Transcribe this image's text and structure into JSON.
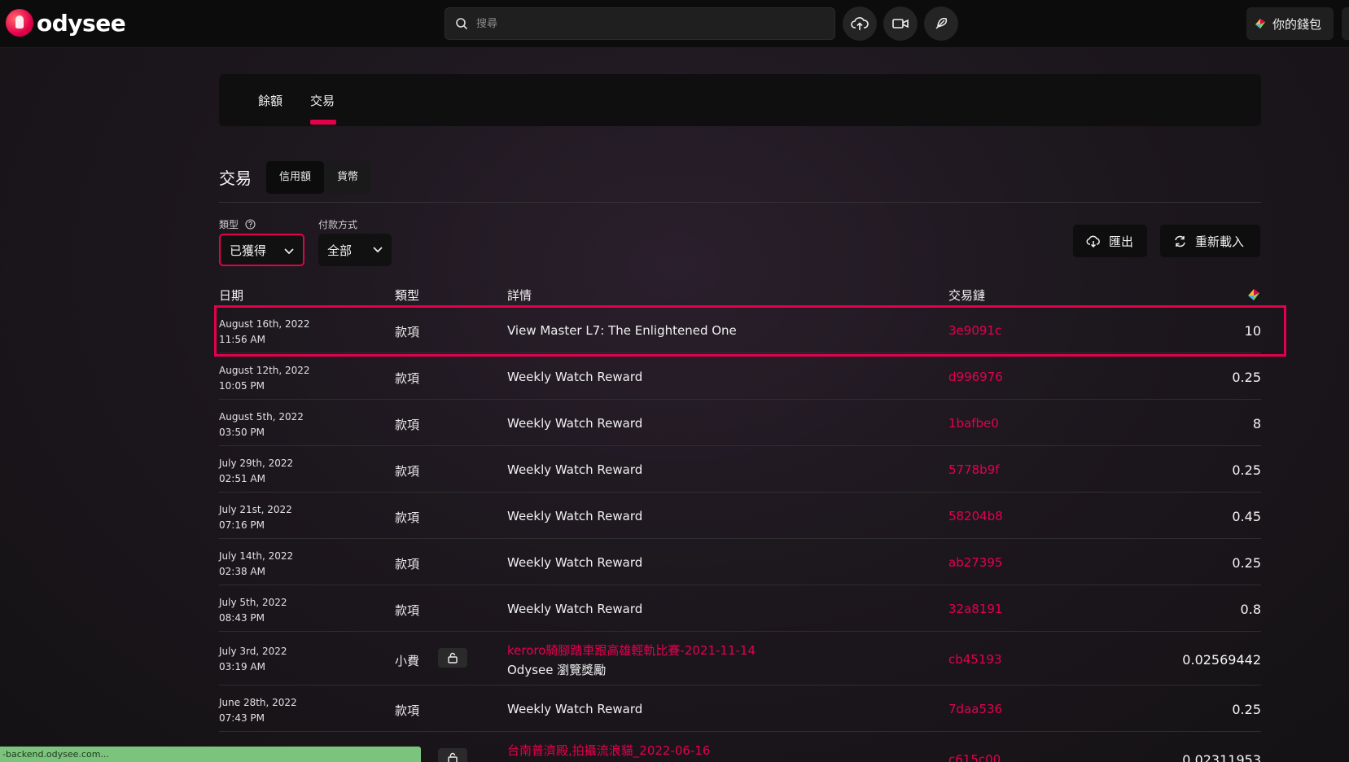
{
  "header": {
    "logo_text": "odysee",
    "search_placeholder": "搜尋",
    "wallet_label": "你的錢包"
  },
  "tabs": [
    {
      "label": "餘額",
      "active": false
    },
    {
      "label": "交易",
      "active": true
    }
  ],
  "section": {
    "title": "交易",
    "segments": [
      "信用額",
      "貨幣"
    ],
    "active_segment": "信用額"
  },
  "filters": {
    "type_label": "類型",
    "type_value": "已獲得",
    "payment_label": "付款方式",
    "payment_value": "全部"
  },
  "actions": {
    "export_label": "匯出",
    "reload_label": "重新載入"
  },
  "table": {
    "headers": {
      "date": "日期",
      "type": "類型",
      "details": "詳情",
      "txid": "交易鏈"
    },
    "rows": [
      {
        "date": "August 16th, 2022",
        "time": "11:56 AM",
        "type": "款項",
        "detail": "View Master L7: The Enlightened One",
        "txid": "3e9091c",
        "amount": "10"
      },
      {
        "date": "August 12th, 2022",
        "time": "10:05 PM",
        "type": "款項",
        "detail": "Weekly Watch Reward",
        "txid": "d996976",
        "amount": "0.25"
      },
      {
        "date": "August 5th, 2022",
        "time": "03:50 PM",
        "type": "款項",
        "detail": "Weekly Watch Reward",
        "txid": "1bafbe0",
        "amount": "8"
      },
      {
        "date": "July 29th, 2022",
        "time": "02:51 AM",
        "type": "款項",
        "detail": "Weekly Watch Reward",
        "txid": "5778b9f",
        "amount": "0.25"
      },
      {
        "date": "July 21st, 2022",
        "time": "07:16 PM",
        "type": "款項",
        "detail": "Weekly Watch Reward",
        "txid": "58204b8",
        "amount": "0.45"
      },
      {
        "date": "July 14th, 2022",
        "time": "02:38 AM",
        "type": "款項",
        "detail": "Weekly Watch Reward",
        "txid": "ab27395",
        "amount": "0.25"
      },
      {
        "date": "July 5th, 2022",
        "time": "08:43 PM",
        "type": "款項",
        "detail": "Weekly Watch Reward",
        "txid": "32a8191",
        "amount": "0.8"
      },
      {
        "date": "July 3rd, 2022",
        "time": "03:19 AM",
        "type": "小費",
        "detail_link": "keroro騎腳踏車跟高雄輕軌比賽-2021-11-14",
        "detail": "Odysee 瀏覽獎勵",
        "txid": "cb45193",
        "amount": "0.02569442"
      },
      {
        "date": "June 28th, 2022",
        "time": "07:43 PM",
        "type": "款項",
        "detail": "Weekly Watch Reward",
        "txid": "7daa536",
        "amount": "0.25"
      },
      {
        "detail_link": "台南普濟殿,拍攝流浪貓_2022-06-16",
        "txid": "c615c00",
        "amount": "0.02311953"
      }
    ]
  },
  "status_bar": "-backend.odysee.com...",
  "colors": {
    "accent": "#e5004c",
    "status_bar": "#7cc47e"
  }
}
